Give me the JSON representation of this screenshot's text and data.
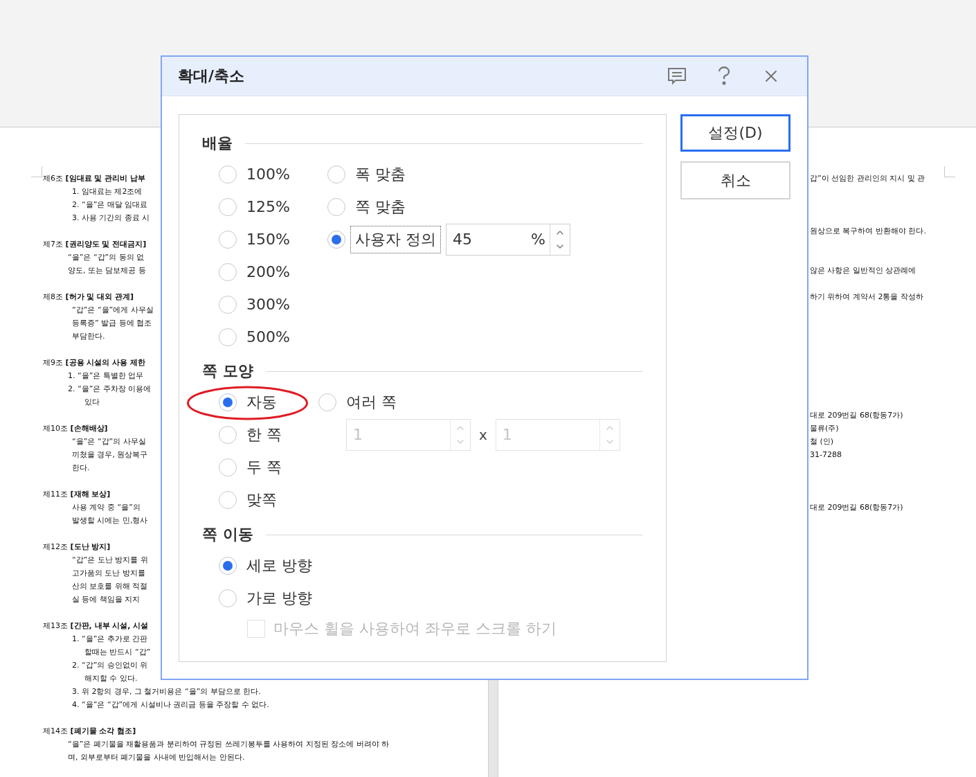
{
  "document": {
    "left_page": [
      {
        "kind": "heading",
        "text": "제6조 **[임대료 및 관리비 납부**"
      },
      {
        "kind": "item",
        "text": "1. 임대료는 제2조에"
      },
      {
        "kind": "item",
        "text": "2. “을”은 매달 임대료"
      },
      {
        "kind": "item",
        "text": "3. 사용 기간의 종료 시"
      },
      {
        "kind": "blank"
      },
      {
        "kind": "heading",
        "text": "제7조 **[권리양도 및 전대금지]**"
      },
      {
        "kind": "para",
        "text": "“을”은 “갑”의 동의 없"
      },
      {
        "kind": "para",
        "text": "양도, 또는 담보제공 등"
      },
      {
        "kind": "blank"
      },
      {
        "kind": "heading",
        "text": "제8조 **[허가 및 대외 관계]**"
      },
      {
        "kind": "item",
        "text": "“갑”은 “을”에게 사무실"
      },
      {
        "kind": "item",
        "text": "등록증” 발급 등에 협조"
      },
      {
        "kind": "item",
        "text": "부담한다."
      },
      {
        "kind": "blank"
      },
      {
        "kind": "heading",
        "text": "제9조 **[공용 시설의 사용 제한**"
      },
      {
        "kind": "para",
        "text": "1. “을”은 특별한 업무"
      },
      {
        "kind": "para",
        "text": "2. “을”은 주차장 이용에"
      },
      {
        "kind": "cont",
        "text": "있다"
      },
      {
        "kind": "blank"
      },
      {
        "kind": "heading",
        "text": "제10조 **[손해배상]**"
      },
      {
        "kind": "item",
        "text": "“을”은 “갑”의 사무실"
      },
      {
        "kind": "item",
        "text": "끼쳤을 경우, 원상복구"
      },
      {
        "kind": "item",
        "text": "한다."
      },
      {
        "kind": "blank"
      },
      {
        "kind": "heading",
        "text": "제11조 **[재해 보상]**"
      },
      {
        "kind": "item",
        "text": "사용 계약 중 “을”의"
      },
      {
        "kind": "item",
        "text": "발생할 시에는 민,형사"
      },
      {
        "kind": "blank"
      },
      {
        "kind": "heading",
        "text": "제12조 **[도난 방지]**"
      },
      {
        "kind": "item",
        "text": "“갑”은 도난 방지를 위"
      },
      {
        "kind": "item",
        "text": "고가품의 도난 방지를"
      },
      {
        "kind": "item",
        "text": "산의 보호를 위해 적절"
      },
      {
        "kind": "item",
        "text": "실 등에 책임을 지지"
      },
      {
        "kind": "blank"
      },
      {
        "kind": "heading",
        "text": "제13조 **[간판, 내부 시설, 시설**"
      },
      {
        "kind": "item",
        "text": "1. “을”은 추가로 간판"
      },
      {
        "kind": "cont",
        "text": "할때는 반드시 “갑”"
      },
      {
        "kind": "item",
        "text": "2. “갑”의 승인없이 위"
      },
      {
        "kind": "cont",
        "text": "해지할 수 있다."
      },
      {
        "kind": "item",
        "text": "3. 위 2항의 경우, 그 철거비용은 “을”의 부담으로 한다."
      },
      {
        "kind": "item",
        "text": "4. “을”은 “갑”에게 시설비나 권리금 등을 주장할 수 없다."
      },
      {
        "kind": "blank"
      },
      {
        "kind": "heading",
        "text": "제14조 **[폐기물 소각 협조]**"
      },
      {
        "kind": "para",
        "text": "“을”은 폐기물을 재활용품과 분리하여 규정된 쓰레기봉투를 사용하여 지정된 장소에 버려야 하"
      },
      {
        "kind": "para",
        "text": "며, 외부로부터 폐기물을 사내에 반입해서는 안된다."
      }
    ],
    "right_page": [
      {
        "kind": "text",
        "text": "갑”이 선임한 관리인의 지시 및 관"
      },
      {
        "kind": "blank"
      },
      {
        "kind": "blank"
      },
      {
        "kind": "blank"
      },
      {
        "kind": "text",
        "text": "원상으로 복구하여 반환해야 한다."
      },
      {
        "kind": "blank"
      },
      {
        "kind": "blank"
      },
      {
        "kind": "text",
        "text": "않은 사항은 일반적인 상관례에"
      },
      {
        "kind": "blank"
      },
      {
        "kind": "text",
        "text": "하기 위하여 계약서 2통을 작성하"
      },
      {
        "kind": "blank"
      },
      {
        "kind": "blank"
      },
      {
        "kind": "blank"
      },
      {
        "kind": "blank"
      },
      {
        "kind": "blank"
      },
      {
        "kind": "blank"
      },
      {
        "kind": "blank"
      },
      {
        "kind": "blank"
      },
      {
        "kind": "text",
        "text": "대로 209번길 68(항동7가)"
      },
      {
        "kind": "text",
        "text": "물류(주)"
      },
      {
        "kind": "text",
        "text": "철 (인)"
      },
      {
        "kind": "text",
        "text": "31-7288"
      },
      {
        "kind": "blank"
      },
      {
        "kind": "blank"
      },
      {
        "kind": "blank"
      },
      {
        "kind": "text",
        "text": "대로 209번길 68(항동7가)"
      }
    ]
  },
  "dialog": {
    "title": "확대/축소",
    "scale": {
      "title": "배율",
      "presets": [
        {
          "label": "100%",
          "selected": false
        },
        {
          "label": "125%",
          "selected": false
        },
        {
          "label": "150%",
          "selected": false
        },
        {
          "label": "200%",
          "selected": false
        },
        {
          "label": "300%",
          "selected": false
        },
        {
          "label": "500%",
          "selected": false
        }
      ],
      "fit_modes": [
        {
          "kind": "plain",
          "label": "폭 맞춤",
          "selected": false,
          "focused": false
        },
        {
          "kind": "plain",
          "label": "쪽 맞춤",
          "selected": false,
          "focused": false
        },
        {
          "kind": "custom",
          "label": "사용자 정의",
          "selected": true,
          "focused": true
        }
      ],
      "custom_field": {
        "value": "45",
        "unit": "%"
      }
    },
    "page_layout": {
      "title": "쪽 모양",
      "options": [
        {
          "label": "자동",
          "selected": true,
          "circled": true
        },
        {
          "label": "한 쪽",
          "selected": false,
          "circled": false
        },
        {
          "label": "두 쪽",
          "selected": false,
          "circled": false
        },
        {
          "label": "맞쪽",
          "selected": false,
          "circled": false
        }
      ],
      "multi": {
        "label": "여러 쪽",
        "selected": false,
        "disabled": true,
        "first": "1",
        "separator": "x",
        "second": "1"
      }
    },
    "page_move": {
      "title": "쪽 이동",
      "options": [
        {
          "label": "세로 방향",
          "selected": true
        },
        {
          "label": "가로 방향",
          "selected": false
        }
      ],
      "wheel_checkbox": {
        "label": "마우스 휠을 사용하여 좌우로 스크롤 하기",
        "checked": false,
        "disabled": true
      }
    },
    "buttons": [
      {
        "label": "설정(D)",
        "default": true
      },
      {
        "label": "취소",
        "default": false
      }
    ]
  }
}
